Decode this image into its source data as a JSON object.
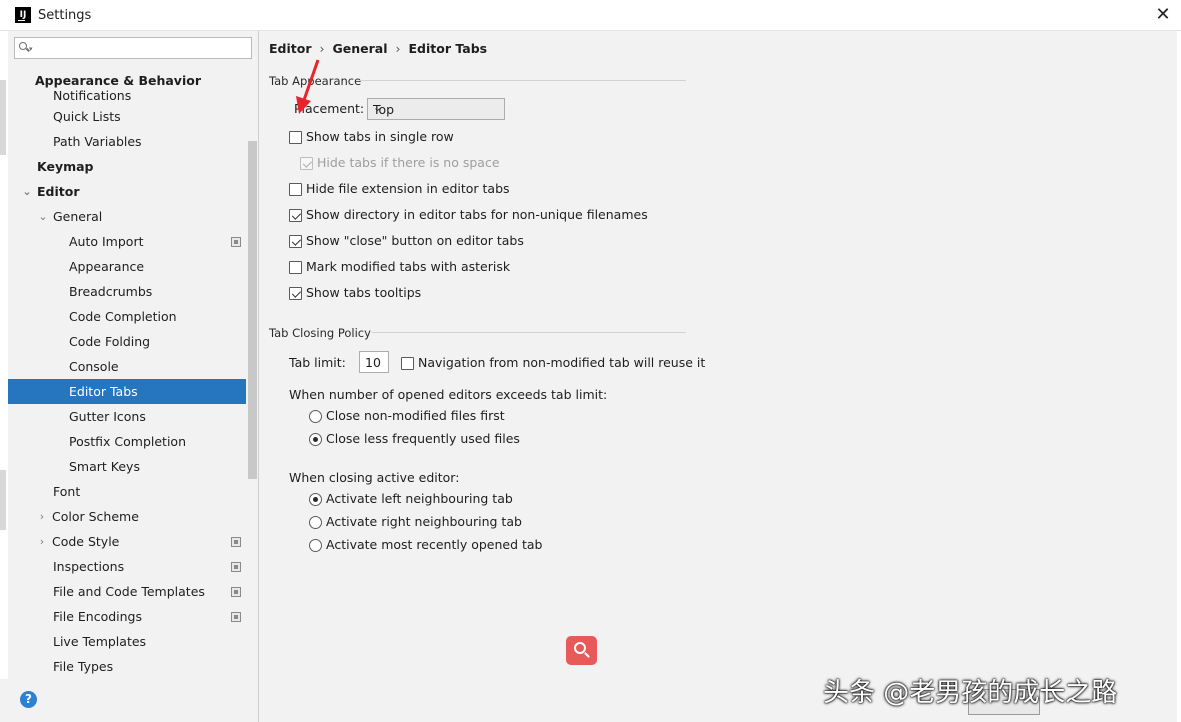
{
  "window": {
    "title": "Settings",
    "close_glyph": "✕",
    "app_icon": "IJ"
  },
  "search": {
    "placeholder": "",
    "icon": "search-icon"
  },
  "tree": [
    {
      "label": "Appearance & Behavior",
      "bold": true
    },
    {
      "label": "Notifications"
    },
    {
      "label": "Quick Lists"
    },
    {
      "label": "Path Variables"
    },
    {
      "label": "Keymap",
      "bold": true
    },
    {
      "label": "Editor",
      "bold": true,
      "expanded": true
    },
    {
      "label": "General",
      "expanded": true
    },
    {
      "label": "Auto Import",
      "project_icon": true
    },
    {
      "label": "Appearance"
    },
    {
      "label": "Breadcrumbs"
    },
    {
      "label": "Code Completion"
    },
    {
      "label": "Code Folding"
    },
    {
      "label": "Console"
    },
    {
      "label": "Editor Tabs",
      "selected": true
    },
    {
      "label": "Gutter Icons"
    },
    {
      "label": "Postfix Completion"
    },
    {
      "label": "Smart Keys"
    },
    {
      "label": "Font"
    },
    {
      "label": "Color Scheme",
      "collapsed": true
    },
    {
      "label": "Code Style",
      "collapsed": true,
      "project_icon": true
    },
    {
      "label": "Inspections",
      "project_icon": true
    },
    {
      "label": "File and Code Templates",
      "project_icon": true
    },
    {
      "label": "File Encodings",
      "project_icon": true
    },
    {
      "label": "Live Templates"
    },
    {
      "label": "File Types"
    }
  ],
  "help": {
    "glyph": "?"
  },
  "breadcrumb": [
    "Editor",
    "General",
    "Editor Tabs"
  ],
  "breadcrumb_sep": "›",
  "tab_appearance": {
    "title": "Tab Appearance",
    "placement_label": "Placement:",
    "placement_value": "Top",
    "options": [
      {
        "label": "Show tabs in single row",
        "checked": false
      },
      {
        "label": "Hide tabs if there is no space",
        "checked": true,
        "disabled": true
      },
      {
        "label": "Hide file extension in editor tabs",
        "checked": false
      },
      {
        "label": "Show directory in editor tabs for non-unique filenames",
        "checked": true
      },
      {
        "label": "Show \"close\" button on editor tabs",
        "checked": true
      },
      {
        "label": "Mark modified tabs with asterisk",
        "checked": false
      },
      {
        "label": "Show tabs tooltips",
        "checked": true
      }
    ]
  },
  "tab_closing": {
    "title": "Tab Closing Policy",
    "tab_limit_label": "Tab limit:",
    "tab_limit_value": "10",
    "reuse_label": "Navigation from non-modified tab will reuse it",
    "reuse_checked": false,
    "exceeds_label": "When number of opened editors exceeds tab limit:",
    "exceeds_options": [
      {
        "label": "Close non-modified files first",
        "selected": false
      },
      {
        "label": "Close less frequently used files",
        "selected": true
      }
    ],
    "closing_label": "When closing active editor:",
    "closing_options": [
      {
        "label": "Activate left neighbouring tab",
        "selected": true
      },
      {
        "label": "Activate right neighbouring tab",
        "selected": false
      },
      {
        "label": "Activate most recently opened tab",
        "selected": false
      }
    ]
  },
  "watermark": "头条 @老男孩的成长之路",
  "colors": {
    "selection": "#2675bf",
    "annotation_arrow": "#e8242a",
    "search_fab": "#e8595a",
    "panel_bg": "#f2f2f2"
  }
}
